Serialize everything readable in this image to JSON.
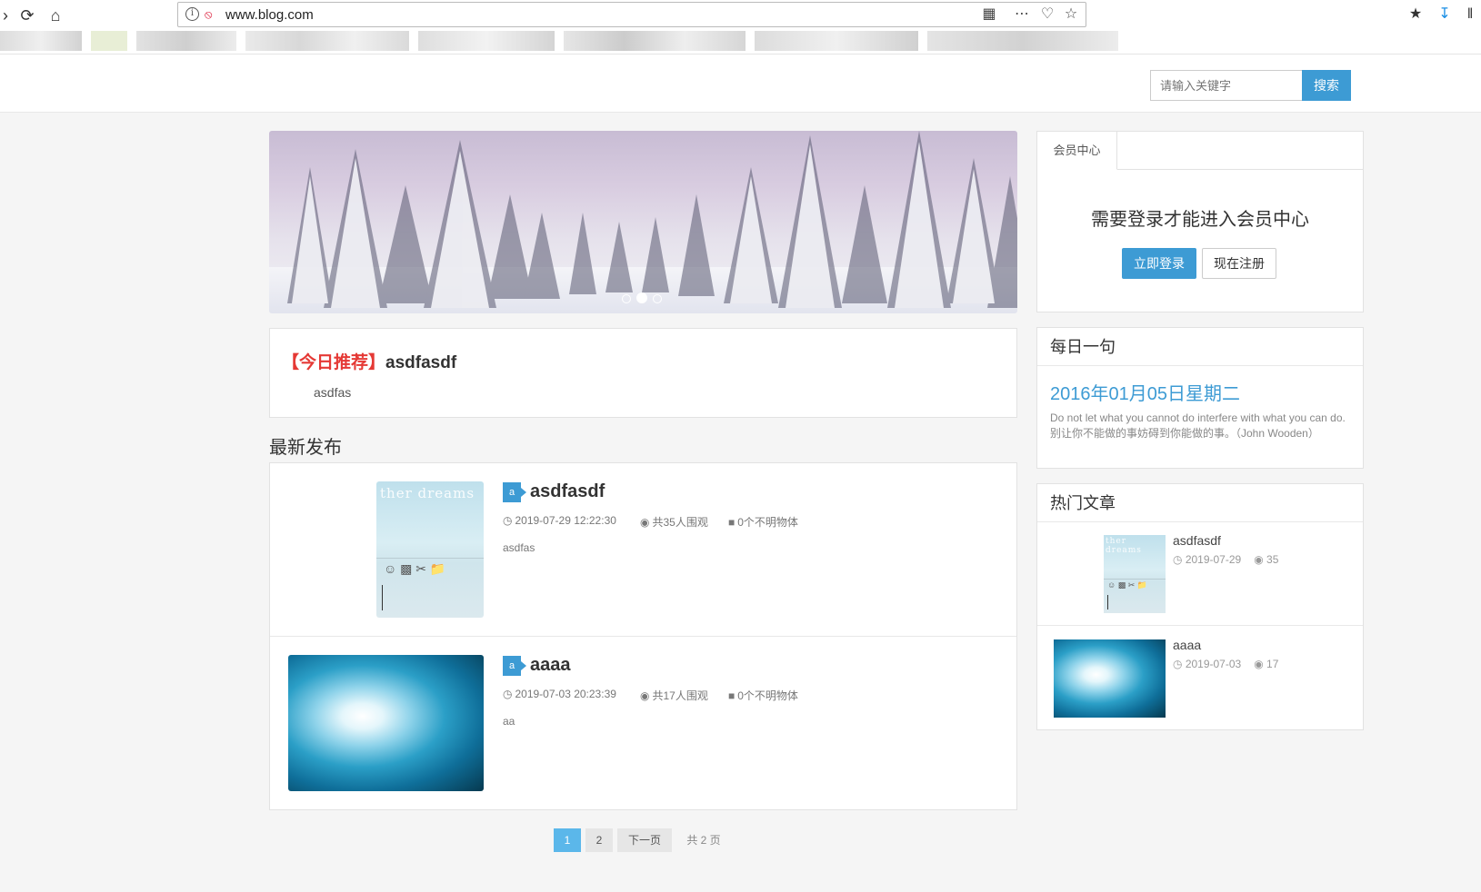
{
  "browser": {
    "url": "www.blog.com",
    "back_icon": "back-arrow-icon",
    "reload_icon": "reload-icon",
    "home_icon": "home-icon"
  },
  "header": {
    "search_placeholder": "请输入关键字",
    "search_label": "搜索"
  },
  "carousel": {
    "dots": 3,
    "active_dot": 2
  },
  "recommend": {
    "tag": "【今日推荐】",
    "title": "asdfasdf",
    "body": "asdfas"
  },
  "latest": {
    "section_title": "最新发布",
    "posts": [
      {
        "badge": "a",
        "title": "asdfasdf",
        "time": "2019-07-29 12:22:30",
        "views": "共35人围观",
        "comments": "0个不明物体",
        "desc": "asdfas",
        "thumb_text": "ther dreams"
      },
      {
        "badge": "a",
        "title": "aaaa",
        "time": "2019-07-03 20:23:39",
        "views": "共17人围观",
        "comments": "0个不明物体",
        "desc": "aa"
      }
    ]
  },
  "pagination": {
    "pages": [
      "1",
      "2"
    ],
    "next": "下一页",
    "total": "共 2 页",
    "current": "1"
  },
  "member": {
    "tab": "会员中心",
    "message": "需要登录才能进入会员中心",
    "login": "立即登录",
    "register": "现在注册"
  },
  "daily": {
    "title": "每日一句",
    "date": "2016年01月05日星期二",
    "quote_en": "Do not let what you cannot do interfere with what you can do.",
    "quote_cn": "别让你不能做的事妨碍到你能做的事。（John Wooden）"
  },
  "hot": {
    "title": "热门文章",
    "items": [
      {
        "title": "asdfasdf",
        "date": "2019-07-29",
        "views": "35",
        "thumb_text": "ther dreams"
      },
      {
        "title": "aaaa",
        "date": "2019-07-03",
        "views": "17"
      }
    ]
  },
  "colors": {
    "accent": "#3d9bd4",
    "recommend_tag": "#e53935",
    "page_active": "#5bb7ea"
  }
}
